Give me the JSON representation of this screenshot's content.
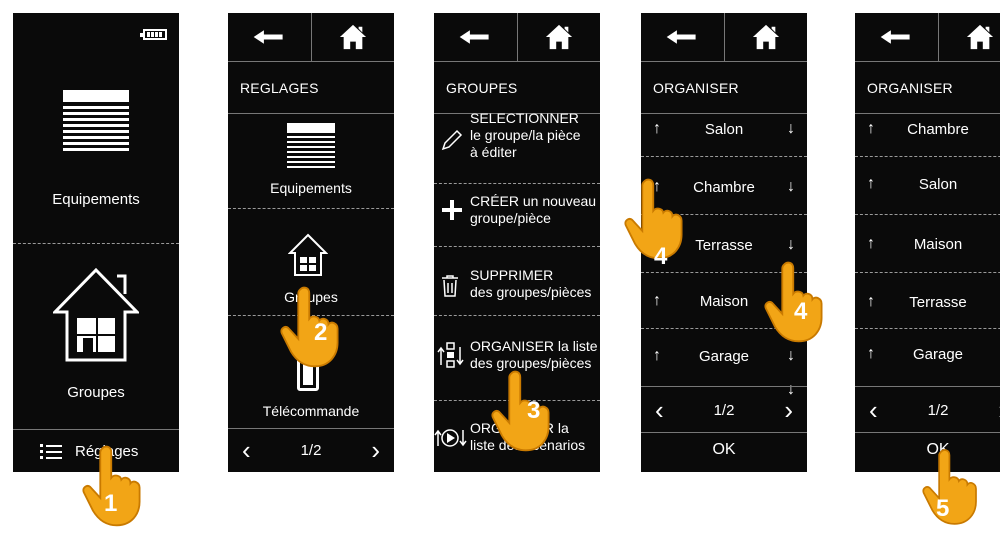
{
  "colors": {
    "screen": "#0a0a0a",
    "hand": "#f2a516",
    "hand_outline": "#c97a00",
    "divider": "#9a9a9a"
  },
  "screen1": {
    "battery_icon": "battery-icon",
    "equipements": "Equipements",
    "groupes": "Groupes",
    "reglages": "Réglages"
  },
  "screen2": {
    "title": "REGLAGES",
    "equipements": "Equipements",
    "groupes": "Groupes",
    "telecommande": "Télécommande",
    "page": "1/2"
  },
  "screen3": {
    "title": "GROUPES",
    "items": [
      {
        "line1": "SELECTIONNER",
        "line2": "le groupe/la pièce",
        "line3": "à éditer"
      },
      {
        "line1": "CRÉER un nouveau",
        "line2": "groupe/pièce"
      },
      {
        "line1": "SUPPRIMER",
        "line2": "des groupes/pièces"
      },
      {
        "line1": "ORGANISER la liste",
        "line2": "des groupes/pièces"
      },
      {
        "line1": "ORGANISER la",
        "line2": "liste des scénarios"
      }
    ]
  },
  "screen4": {
    "title": "ORGANISER",
    "rows": [
      "Salon",
      "Chambre",
      "Terrasse",
      "Maison",
      "Garage"
    ],
    "page": "1/2",
    "ok": "OK"
  },
  "screen5": {
    "title": "ORGANISER",
    "rows": [
      "Chambre",
      "Salon",
      "Maison",
      "Terrasse",
      "Garage"
    ],
    "page": "1/2",
    "ok": "OK"
  },
  "steps": [
    "1",
    "2",
    "3",
    "4",
    "4",
    "5"
  ]
}
